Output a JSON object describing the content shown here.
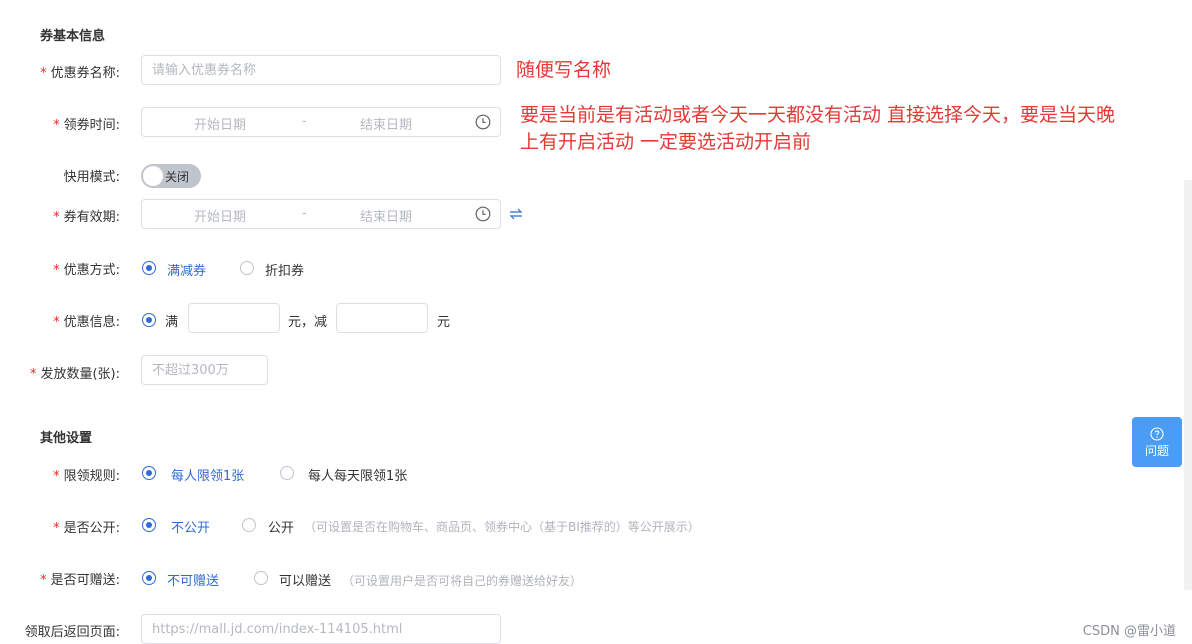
{
  "sections": {
    "basic_title": "券基本信息",
    "other_title": "其他设置"
  },
  "fields": {
    "coupon_name": {
      "label": "优惠券名称:",
      "placeholder": "请输入优惠券名称"
    },
    "claim_time": {
      "label": "领券时间:",
      "start_placeholder": "开始日期",
      "separator": "-",
      "end_placeholder": "结束日期"
    },
    "quick_mode": {
      "label": "快用模式:",
      "toggle_text": "关闭"
    },
    "valid_period": {
      "label": "券有效期:",
      "start_placeholder": "开始日期",
      "separator": "-",
      "end_placeholder": "结束日期"
    },
    "discount_type": {
      "label": "优惠方式:",
      "options": [
        "满减券",
        "折扣券"
      ],
      "selected": "满减券"
    },
    "discount_info": {
      "label": "优惠信息:",
      "prefix": "满",
      "middle": "元，减",
      "suffix": "元"
    },
    "issue_count": {
      "label": "发放数量(张):",
      "placeholder": "不超过300万"
    },
    "limit_rule": {
      "label": "限领规则:",
      "options": [
        "每人限领1张",
        "每人每天限领1张"
      ],
      "selected": "每人限领1张"
    },
    "is_public": {
      "label": "是否公开:",
      "options": [
        "不公开",
        "公开"
      ],
      "selected": "不公开",
      "hint": "（可设置是否在购物车、商品页、领券中心（基于BI推荐的）等公开展示）"
    },
    "giftable": {
      "label": "是否可赠送:",
      "options": [
        "不可赠送",
        "可以赠送"
      ],
      "selected": "不可赠送",
      "hint": "（可设置用户是否可将自己的券赠送给好友）"
    },
    "return_page": {
      "label": "领取后返回页面:",
      "placeholder": "https://mall.jd.com/index-114105.html"
    }
  },
  "annotations": {
    "name_note": "随便写名称",
    "time_note_line1": "要是当前是有活动或者今天一天都没有活动 直接选择今天，要是当天晚",
    "time_note_line2": "上有开启活动 一定要选活动开启前"
  },
  "help_button": {
    "label": "问题"
  },
  "watermark": "CSDN @雷小道",
  "colors": {
    "accent": "#2f6bd8",
    "required": "#f5222d",
    "annotation": "#e53935",
    "help_bg": "#4a9cf5"
  }
}
